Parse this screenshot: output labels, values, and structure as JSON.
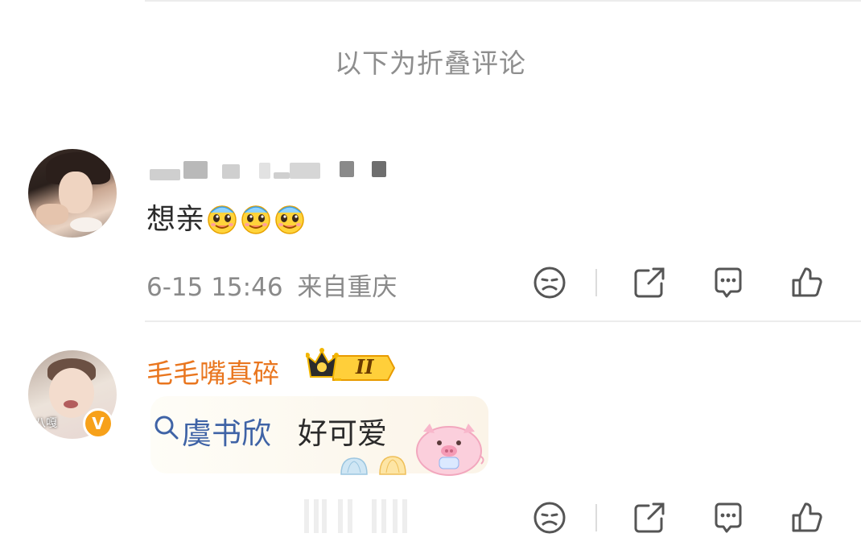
{
  "fold_label": "以下为折叠评论",
  "comments": [
    {
      "text": "想亲",
      "emoji_count": 3,
      "emoji_name": "drooling-face-icon",
      "time": "6-15 15:46",
      "location": "来自重庆",
      "actions": [
        "dislike-icon",
        "share-icon",
        "reply-icon",
        "like-icon"
      ]
    },
    {
      "username": "毛毛嘴真碎",
      "level_badge": "II",
      "avatar_caption": "八嘎",
      "verified_mark": "V",
      "topic": "虞书欣",
      "text": "好可爱",
      "sticker": "pink-pig-sticker",
      "actions": [
        "dislike-icon",
        "share-icon",
        "reply-icon",
        "like-icon"
      ]
    }
  ],
  "colors": {
    "username": "#e9761f",
    "topic": "#3f63a6",
    "meta": "#8a8a8a",
    "fold_label": "#8e8e8e"
  }
}
